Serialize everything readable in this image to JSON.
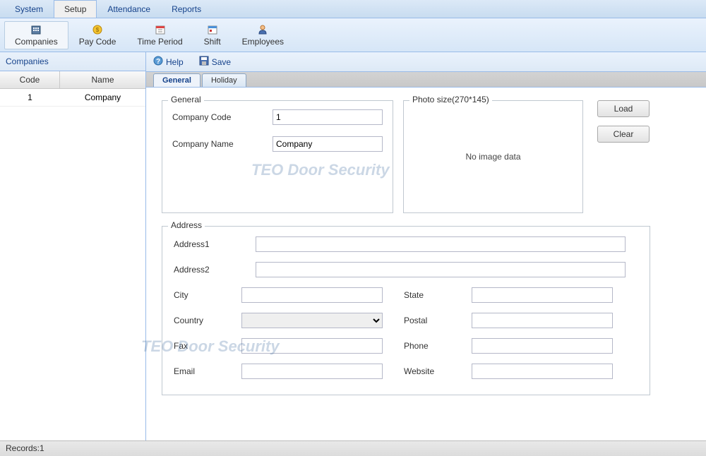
{
  "menu": {
    "items": [
      "System",
      "Setup",
      "Attendance",
      "Reports"
    ],
    "activeIndex": 1
  },
  "toolbar": {
    "items": [
      {
        "label": "Companies",
        "icon": "companies"
      },
      {
        "label": "Pay Code",
        "icon": "paycode"
      },
      {
        "label": "Time Period",
        "icon": "timeperiod"
      },
      {
        "label": "Shift",
        "icon": "shift"
      },
      {
        "label": "Employees",
        "icon": "employees"
      }
    ],
    "activeIndex": 0
  },
  "sidebar": {
    "title": "Companies",
    "columns": {
      "code": "Code",
      "name": "Name"
    },
    "rows": [
      {
        "code": "1",
        "name": "Company"
      }
    ]
  },
  "actions": {
    "help": "Help",
    "save": "Save"
  },
  "tabs": {
    "items": [
      "General",
      "Holiday"
    ],
    "activeIndex": 0
  },
  "form": {
    "general": {
      "legend": "General",
      "companyCodeLabel": "Company Code",
      "companyCodeValue": "1",
      "companyNameLabel": "Company Name",
      "companyNameValue": "Company"
    },
    "photo": {
      "legend": "Photo size(270*145)",
      "empty": "No image data",
      "loadBtn": "Load",
      "clearBtn": "Clear"
    },
    "address": {
      "legend": "Address",
      "address1Label": "Address1",
      "address1Value": "",
      "address2Label": "Address2",
      "address2Value": "",
      "cityLabel": "City",
      "cityValue": "",
      "stateLabel": "State",
      "stateValue": "",
      "countryLabel": "Country",
      "countryValue": "",
      "postalLabel": "Postal",
      "postalValue": "",
      "faxLabel": "Fax",
      "faxValue": "",
      "phoneLabel": "Phone",
      "phoneValue": "",
      "emailLabel": "Email",
      "emailValue": "",
      "websiteLabel": "Website",
      "websiteValue": ""
    }
  },
  "status": {
    "records": "Records:1"
  },
  "watermark": "TEO Door Security"
}
